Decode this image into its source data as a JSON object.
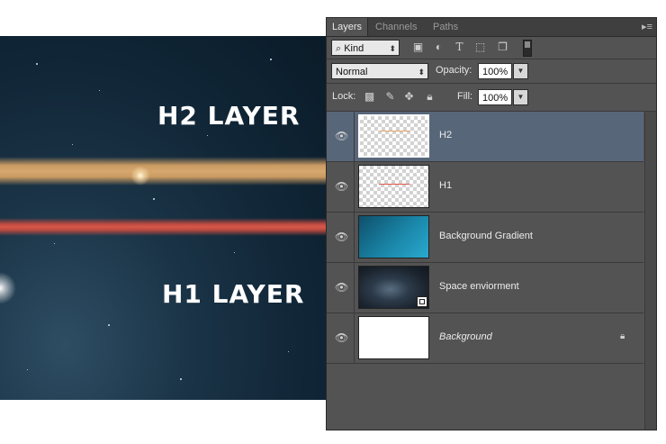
{
  "canvas": {
    "h2_text": "H2 LAYER",
    "h1_text": "H1 LAYER"
  },
  "panel": {
    "tabs": [
      {
        "label": "Layers",
        "active": true
      },
      {
        "label": "Channels",
        "active": false
      },
      {
        "label": "Paths",
        "active": false
      }
    ],
    "filter": {
      "kind_label": "Kind",
      "icons": [
        "image-filter-icon",
        "adjustment-filter-icon",
        "type-filter-icon",
        "shape-filter-icon",
        "smart-object-filter-icon",
        "filter-toggle-icon"
      ]
    },
    "blend": {
      "mode": "Normal",
      "opacity_label": "Opacity:",
      "opacity_value": "100%"
    },
    "lock": {
      "label": "Lock:",
      "icons": [
        "lock-transparent-icon",
        "lock-brush-icon",
        "lock-move-icon",
        "lock-all-icon"
      ],
      "fill_label": "Fill:",
      "fill_value": "100%"
    },
    "layers": [
      {
        "name": "H2",
        "selected": true,
        "italic": false
      },
      {
        "name": "H1",
        "selected": false,
        "italic": false
      },
      {
        "name": "Background Gradient",
        "selected": false,
        "italic": false
      },
      {
        "name": "Space enviorment",
        "selected": false,
        "italic": false
      },
      {
        "name": "Background",
        "selected": false,
        "italic": true,
        "locked": true
      }
    ]
  },
  "colors": {
    "panel_bg": "#535353",
    "selected_layer": "#586679",
    "h2_band": "#d6a86e",
    "h1_band": "#d4584a"
  }
}
